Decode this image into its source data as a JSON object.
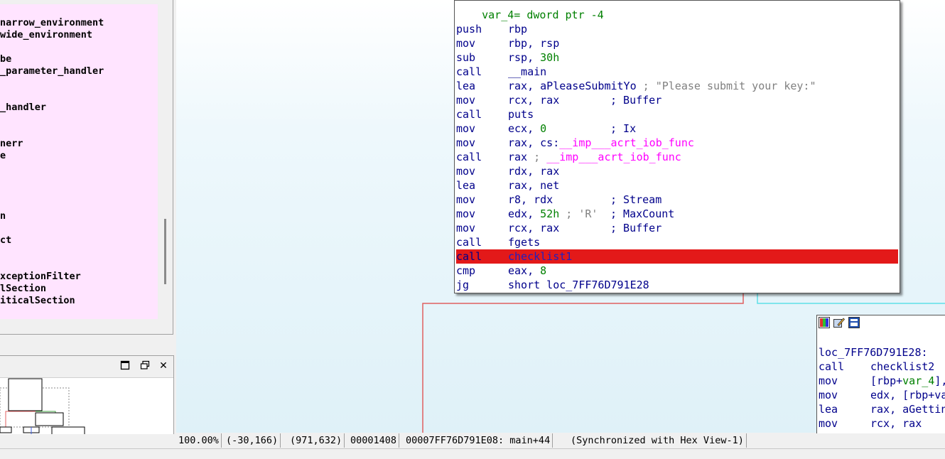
{
  "functions_panel": {
    "items": [
      "narrow_environment",
      "wide_environment",
      "be",
      "_parameter_handler",
      "_handler",
      "nerr",
      "e",
      "n",
      "ct",
      "xceptionFilter",
      "lSection",
      "iticalSection"
    ]
  },
  "overview_panel": {
    "maximize_icon": "maximize-icon",
    "restore_icon": "restore-icon",
    "close_label": "✕"
  },
  "main_block": {
    "header_partial": "var_4= dword ptr -4",
    "lines": [
      {
        "mn": "push",
        "op": "rbp"
      },
      {
        "mn": "mov",
        "op": "rbp, rsp"
      },
      {
        "mn": "sub",
        "op_a": "rsp, ",
        "op_num": "30h"
      },
      {
        "mn": "call",
        "op": "__main"
      },
      {
        "mn": "lea",
        "op": "rax, aPleaseSubmitYo",
        "cmt": "; \"Please submit your key:\""
      },
      {
        "mn": "mov",
        "op": "rcx, rax",
        "cmt2": "; Buffer"
      },
      {
        "mn": "call",
        "op": "puts"
      },
      {
        "mn": "mov",
        "op_a": "ecx, ",
        "op_num": "0",
        "cmt2": "; Ix"
      },
      {
        "mn": "mov",
        "op_a": "rax, cs:",
        "op_imp": "__imp___acrt_iob_func"
      },
      {
        "mn": "call",
        "op_a": "rax",
        "cmt_a": " ; ",
        "op_imp": "__imp___acrt_iob_func"
      },
      {
        "mn": "mov",
        "op": "rdx, rax"
      },
      {
        "mn": "lea",
        "op": "rax, net"
      },
      {
        "mn": "mov",
        "op": "r8, rdx",
        "cmt2": "; Stream"
      },
      {
        "mn": "mov",
        "op_a": "edx, ",
        "op_num": "52h",
        "cmt_b": " ; 'R'",
        "cmt2": "; MaxCount"
      },
      {
        "mn": "mov",
        "op": "rcx, rax",
        "cmt2": "; Buffer"
      },
      {
        "mn": "call",
        "op": "fgets"
      },
      {
        "mn": "call",
        "op": "checklist1",
        "highlight": true
      },
      {
        "mn": "cmp",
        "op_a": "eax, ",
        "op_num": "8"
      },
      {
        "mn": "jg",
        "op": "short loc_7FF76D791E28"
      }
    ]
  },
  "right_block": {
    "label": "loc_7FF76D791E28:",
    "lines": [
      {
        "mn": "call",
        "op": "checklist2"
      },
      {
        "mn": "mov",
        "op_a": "[rbp+",
        "op_var": "var_4",
        "op_b": "],"
      },
      {
        "mn": "mov",
        "op": "edx, [rbp+va"
      },
      {
        "mn": "lea",
        "op": "rax, aGettin"
      },
      {
        "mn": "mov",
        "op": "rcx, rax"
      }
    ]
  },
  "status_bar": {
    "zoom": "100.00%",
    "coords": "(-30,166)",
    "pos": "(971,632)",
    "offset": "00001408",
    "address": "00007FF76D791E08: main+44",
    "sync": "(Synchronized with Hex View-1)"
  },
  "colors": {
    "highlight": "#e31919",
    "func_list_bg": "#ffe4ff",
    "edge_red": "#e06060",
    "edge_cyan": "#5fe0e8"
  }
}
